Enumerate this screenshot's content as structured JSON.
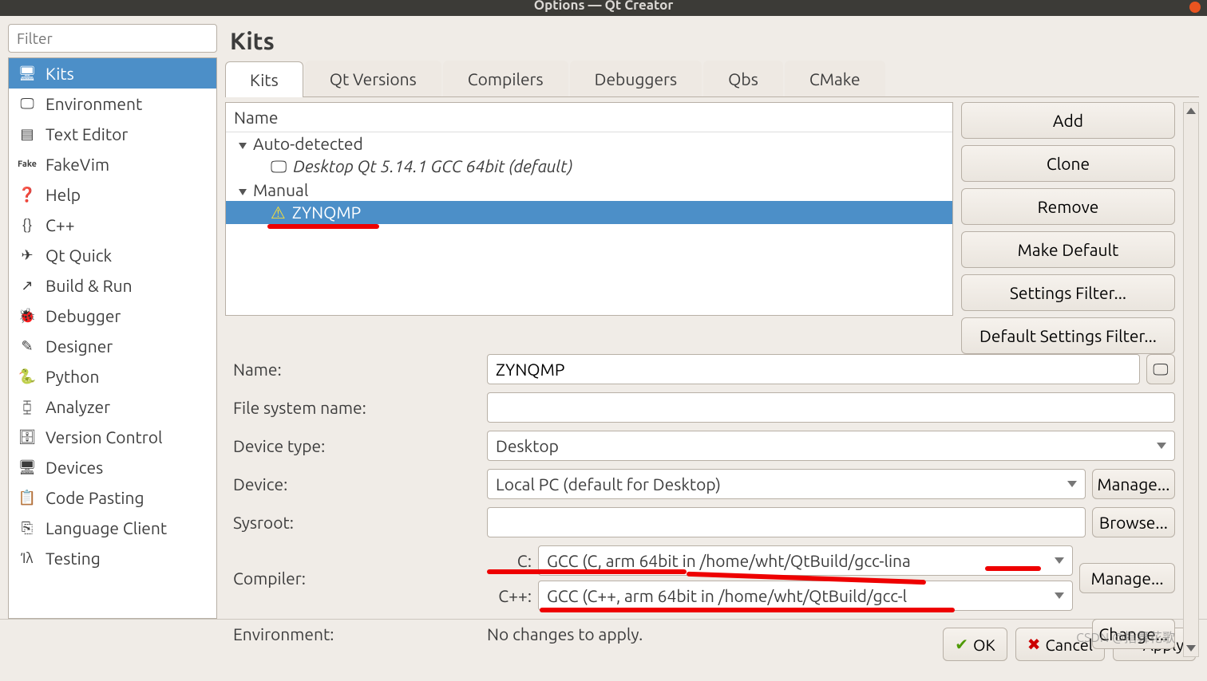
{
  "window": {
    "title": "Options — Qt Creator"
  },
  "sidebar": {
    "filter_placeholder": "Filter",
    "items": [
      {
        "label": "Kits"
      },
      {
        "label": "Environment"
      },
      {
        "label": "Text Editor"
      },
      {
        "label": "FakeVim"
      },
      {
        "label": "Help"
      },
      {
        "label": "C++"
      },
      {
        "label": "Qt Quick"
      },
      {
        "label": "Build & Run"
      },
      {
        "label": "Debugger"
      },
      {
        "label": "Designer"
      },
      {
        "label": "Python"
      },
      {
        "label": "Analyzer"
      },
      {
        "label": "Version Control"
      },
      {
        "label": "Devices"
      },
      {
        "label": "Code Pasting"
      },
      {
        "label": "Language Client"
      },
      {
        "label": "Testing"
      }
    ]
  },
  "panel": {
    "heading": "Kits",
    "tabs": [
      {
        "label": "Kits"
      },
      {
        "label": "Qt Versions"
      },
      {
        "label": "Compilers"
      },
      {
        "label": "Debuggers"
      },
      {
        "label": "Qbs"
      },
      {
        "label": "CMake"
      }
    ],
    "tree": {
      "header": "Name",
      "auto_label": "Auto-detected",
      "auto_item": "Desktop Qt 5.14.1 GCC 64bit (default)",
      "manual_label": "Manual",
      "manual_item": "ZYNQMP"
    },
    "buttons": {
      "add": "Add",
      "clone": "Clone",
      "remove": "Remove",
      "make_default": "Make Default",
      "settings_filter": "Settings Filter...",
      "default_settings_filter": "Default Settings Filter..."
    },
    "form": {
      "name_label": "Name:",
      "name_value": "ZYNQMP",
      "fsname_label": "File system name:",
      "fsname_value": "",
      "devtype_label": "Device type:",
      "devtype_value": "Desktop",
      "device_label": "Device:",
      "device_value": "Local PC (default for Desktop)",
      "device_manage": "Manage...",
      "sysroot_label": "Sysroot:",
      "sysroot_value": "",
      "sysroot_browse": "Browse...",
      "compiler_label": "Compiler:",
      "compiler_c_label": "C:",
      "compiler_c_value": "GCC (C, arm 64bit in /home/wht/QtBuild/gcc-lina",
      "compiler_cpp_label": "C++:",
      "compiler_cpp_value": "GCC (C++, arm 64bit in /home/wht/QtBuild/gcc-l",
      "compiler_manage": "Manage...",
      "env_label": "Environment:",
      "env_value": "No changes to apply.",
      "env_change": "Change..."
    }
  },
  "footer": {
    "ok": "OK",
    "cancel": "Cancel",
    "apply": "Apply"
  },
  "watermark": "CSDN @指舞花歌"
}
